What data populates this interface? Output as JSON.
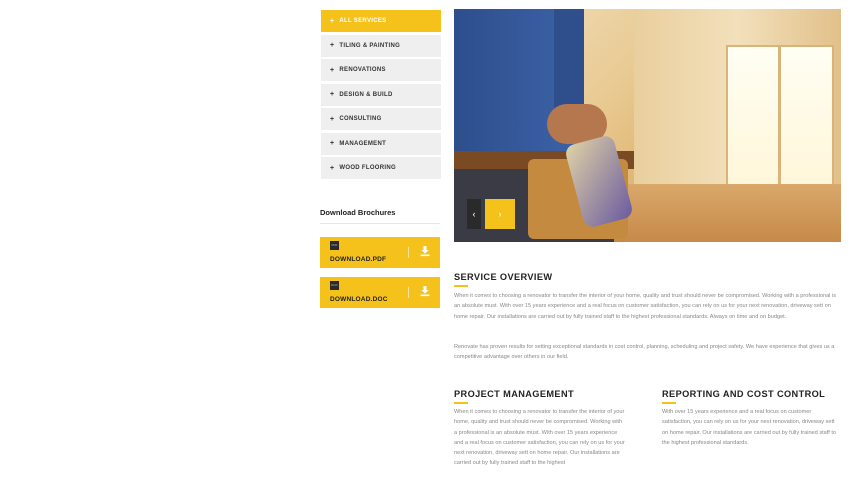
{
  "services": {
    "items": [
      {
        "label": "ALL SERVICES",
        "active": true
      },
      {
        "label": "TILING & PAINTING",
        "active": false
      },
      {
        "label": "RENOVATIONS",
        "active": false
      },
      {
        "label": "DESIGN & BUILD",
        "active": false
      },
      {
        "label": "CONSULTING",
        "active": false
      },
      {
        "label": "MANAGEMENT",
        "active": false
      },
      {
        "label": "WOOD FLOORING",
        "active": false
      }
    ],
    "plus": "+"
  },
  "brochures": {
    "title": "Download Brochures",
    "items": [
      {
        "type": "PDF",
        "label": "DOWNLOAD.PDF"
      },
      {
        "type": "DOC",
        "label": "DOWNLOAD.DOC"
      }
    ]
  },
  "slider": {
    "prev": "‹",
    "next": "›"
  },
  "overview": {
    "title": "SERVICE OVERVIEW",
    "p1": "When it comes to choosing a renovator to transfer the interior of your home, quality and trust should never be compromised. Working with a professional is an absolute must. With over 15 years experience and a real focus on customer satisfaction, you can rely on us for your next renovation, driveway sett on home repair. Our installations are carried out by fully trained staff to the highest professional standards. Always on time and on budget.",
    "p2": "Renovate has proven results for setting exceptional standards in cost control, planning, scheduling and project safety. We have experience that gives us a competitive advantage over others in our field."
  },
  "project": {
    "title": "PROJECT MANAGEMENT",
    "text": "When it comes to choosing a renovator to transfer the interior of your home, quality and trust should never be compromised. Working with a professional is an absolute must. With over 15 years experience and a real focus on customer satisfaction, you can rely on us for your next renovation, driveway sett on home repair. Our installations are carried out by fully trained staff to the highest"
  },
  "reporting": {
    "title": "REPORTING AND COST CONTROL",
    "text": "With over 15 years experience and a real focus on customer satisfaction, you can rely on us for your next renovation, driveway sett on home repair. Our installations are carried out by fully trained staff to the highest professional standards."
  },
  "colors": {
    "accent": "#f5c21b",
    "item_bg": "#efefef",
    "text": "#222222",
    "muted": "#888888"
  }
}
